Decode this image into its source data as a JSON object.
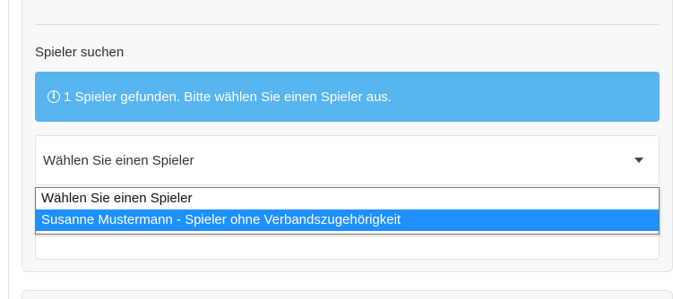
{
  "search_section": {
    "label": "Spieler suchen"
  },
  "alert": {
    "icon": "info-icon",
    "text": "1 Spieler gefunden. Bitte wählen Sie einen Spieler aus.",
    "color": "#57b4ef"
  },
  "player_select": {
    "current_value": "Wählen Sie einen Spieler",
    "options": [
      "Wählen Sie einen Spieler",
      "Susanne Mustermann - Spieler ohne Verbandszugehörigkeit"
    ],
    "highlighted_index": 1,
    "highlight_color": "#1e90ff"
  }
}
